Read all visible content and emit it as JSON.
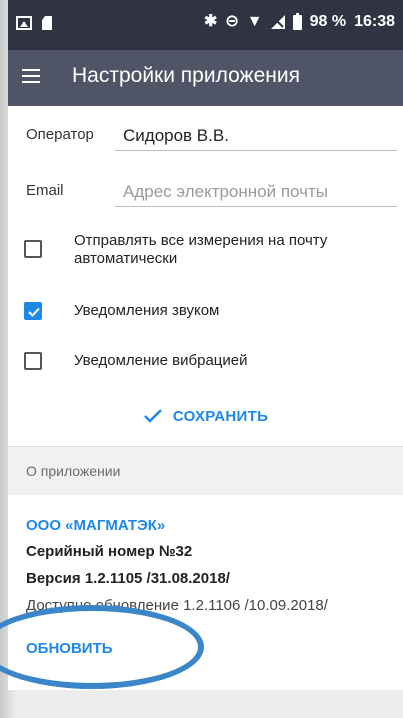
{
  "statusbar": {
    "battery": "98 %",
    "time": "16:38",
    "icons": [
      "image-icon",
      "sim-icon",
      "bluetooth-icon",
      "dnd-icon",
      "wifi-icon",
      "signal-icon",
      "battery-icon"
    ]
  },
  "appbar": {
    "title": "Настройки приложения",
    "menu_icon": "menu-icon"
  },
  "settings": {
    "operator_label": "Оператор",
    "operator_value": "Сидоров В.В.",
    "email_label": "Email",
    "email_placeholder": "Адрес электронной почты",
    "send_all": {
      "label": "Отправлять все измерения на почту автоматически",
      "checked": false
    },
    "sound": {
      "label": "Уведомления звуком",
      "checked": true
    },
    "vibration": {
      "label": "Уведомление вибрацией",
      "checked": false
    },
    "save_label": "СОХРАНИТЬ"
  },
  "about": {
    "header": "О приложении",
    "company": "ООО «МАГМАТЭК»",
    "serial": "Серийный номер №32",
    "version": "Версия 1.2.1105 /31.08.2018/",
    "update_available": "Доступно обновление 1.2.1106 /10.09.2018/",
    "update_button": "ОБНОВИТЬ"
  },
  "colors": {
    "statusbar": "#2f3342",
    "appbar": "#4f5467",
    "accent": "#1e88e5",
    "annotation": "#3a86c8"
  }
}
